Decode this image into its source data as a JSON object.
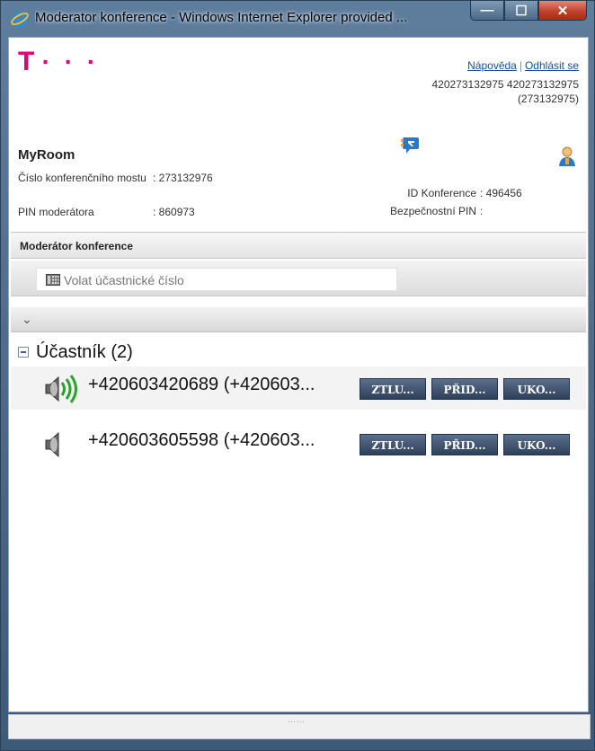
{
  "window": {
    "title": "Moderator konference - Windows Internet Explorer provided ...",
    "minimize_glyph": "—",
    "maximize_glyph": "☐",
    "close_glyph": "✕"
  },
  "header": {
    "logo_text": "T",
    "logo_dots": "· · ·",
    "help_link": "Nápověda",
    "separator": "|",
    "logout_link": "Odhlásit se",
    "user_numbers": "420273132975 420273132975",
    "user_id": "(273132975)"
  },
  "room": {
    "name": "MyRoom",
    "bridge_label": "Číslo konferenčního mostu",
    "bridge_value": ": 273132976",
    "pin_label": "PIN moderátora",
    "pin_value": ": 860973",
    "conference_id_label": "ID Konference",
    "conference_id_value": ": 496456",
    "security_pin_label": "Bezpečnostní PIN",
    "security_pin_value": ":"
  },
  "panel": {
    "title": "Moderátor konference",
    "call_placeholder": "Volat účastnické číslo",
    "collapse_glyph": "⌄"
  },
  "participants": {
    "group_label": "Účastník (2)",
    "items": [
      {
        "number": "+420603420689 (+420603...",
        "mute": "ZTLU...",
        "add": "PŘID...",
        "end": "UKO...",
        "speaking": true
      },
      {
        "number": "+420603605598 (+420603...",
        "mute": "ZTLU...",
        "add": "PŘID...",
        "end": "UKO...",
        "speaking": false
      }
    ]
  },
  "statusbar": {
    "grip": "⋯⋯"
  },
  "colors": {
    "brand": "#e20074",
    "button": "#3a4d6a",
    "sound_wave": "#28a428"
  }
}
